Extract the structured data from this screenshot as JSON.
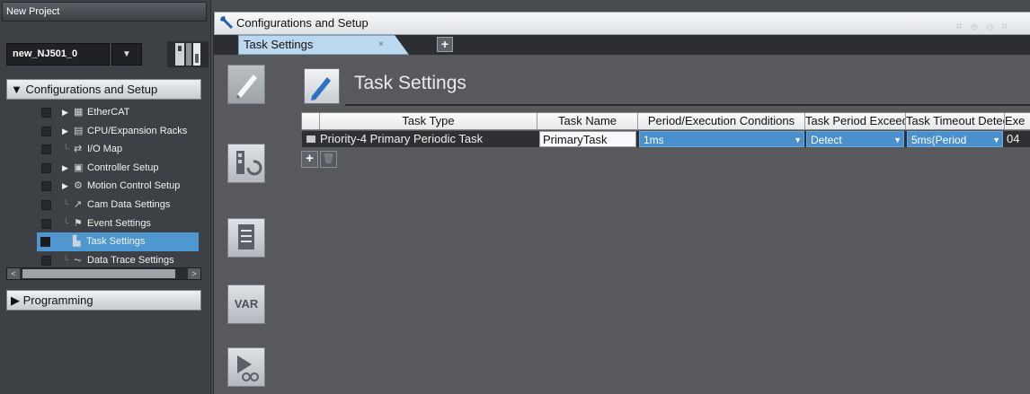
{
  "left_panel": {
    "title": "New Project",
    "device": "new_NJ501_0",
    "device_dropdown": "▼",
    "config_header": "▼ Configurations and Setup",
    "tree_items": [
      {
        "arrow": "▶",
        "icon": "▦",
        "label": "EtherCAT"
      },
      {
        "arrow": "▶",
        "icon": "▤",
        "label": "CPU/Expansion Racks"
      },
      {
        "arrow": "",
        "icon": "⇄",
        "label": "I/O Map"
      },
      {
        "arrow": "▶",
        "icon": "▣",
        "label": "Controller Setup"
      },
      {
        "arrow": "▶",
        "icon": "⚙",
        "label": "Motion Control Setup"
      },
      {
        "arrow": "",
        "icon": "↗",
        "label": "Cam Data Settings"
      },
      {
        "arrow": "",
        "icon": "⚑",
        "label": "Event Settings"
      },
      {
        "arrow": "",
        "icon": "▙",
        "label": "Task Settings"
      },
      {
        "arrow": "",
        "icon": "⏦",
        "label": "Data Trace Settings"
      }
    ],
    "scroll_left": "<",
    "scroll_right": ">",
    "programming_header": "▶ Programming"
  },
  "editor": {
    "window_title": "Configurations and Setup",
    "tab_label": "Task Settings",
    "tab_close": "×",
    "add_tab": "+",
    "side_tools": [
      "edit",
      "io",
      "list",
      "VAR",
      "watch"
    ],
    "var_label": "VAR",
    "section_title": "Task Settings",
    "columns": [
      "Task Type",
      "Task Name",
      "Period/Execution Conditions",
      "Task Period Exceeded",
      "Task Timeout Detection",
      "Exe"
    ],
    "rows": [
      {
        "task_type": "Priority-4 Primary Periodic Task",
        "task_name": "PrimaryTask",
        "period": "1ms",
        "period_exceeded": "Detect",
        "timeout": "5ms(Period",
        "exe": "04"
      }
    ],
    "add_row": "+",
    "delete_row": "🗑",
    "dropdown_glyph": "▼",
    "zoom_tools": "⌗ ⊕ ⊖ ⌗"
  },
  "colors": {
    "accent": "#4f97cf",
    "panel": "#3d4044",
    "editor_bg": "#58595c"
  }
}
